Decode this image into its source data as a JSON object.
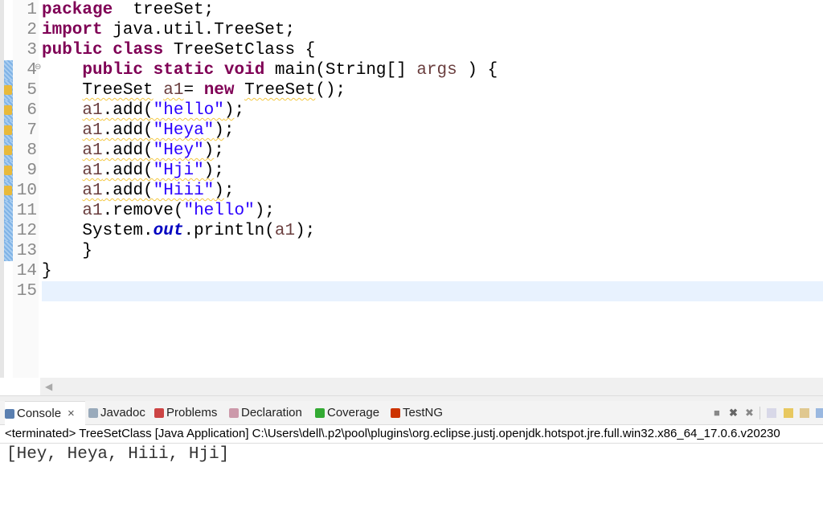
{
  "editor": {
    "lines": [
      {
        "n": "1",
        "t": [
          [
            "kw",
            "package"
          ],
          [
            "",
            "  treeSet;"
          ]
        ]
      },
      {
        "n": "2",
        "t": [
          [
            "kw",
            "import"
          ],
          [
            "",
            " java.util.TreeSet;"
          ]
        ]
      },
      {
        "n": "3",
        "t": [
          [
            "kw",
            "public"
          ],
          [
            "",
            " "
          ],
          [
            "kw",
            "class"
          ],
          [
            "",
            " TreeSetClass {"
          ]
        ]
      },
      {
        "n": "4",
        "fold": true,
        "t": [
          [
            "",
            "    "
          ],
          [
            "kw",
            "public"
          ],
          [
            "",
            " "
          ],
          [
            "kw",
            "static"
          ],
          [
            "",
            " "
          ],
          [
            "kw",
            "void"
          ],
          [
            "",
            " main(String[] "
          ],
          [
            "var",
            "args"
          ],
          [
            "",
            " ) {"
          ]
        ]
      },
      {
        "n": "5",
        "warn": true,
        "t": [
          [
            "",
            "    "
          ],
          [
            "sq",
            "TreeSet"
          ],
          [
            "",
            " "
          ],
          [
            "var sq",
            "a1"
          ],
          [
            "",
            "= "
          ],
          [
            "kw",
            "new"
          ],
          [
            "",
            " "
          ],
          [
            "sq",
            "TreeSet"
          ],
          [
            "",
            "();"
          ]
        ]
      },
      {
        "n": "6",
        "warn": true,
        "t": [
          [
            "",
            "    "
          ],
          [
            "var sq",
            "a1"
          ],
          [
            "sq",
            ".add("
          ],
          [
            "str sq",
            "\"hello\""
          ],
          [
            "sq",
            ")"
          ],
          [
            "",
            ";"
          ]
        ]
      },
      {
        "n": "7",
        "warn": true,
        "t": [
          [
            "",
            "    "
          ],
          [
            "var sq",
            "a1"
          ],
          [
            "sq",
            ".add("
          ],
          [
            "str sq",
            "\"Heya\""
          ],
          [
            "sq",
            ")"
          ],
          [
            "",
            ";"
          ]
        ]
      },
      {
        "n": "8",
        "warn": true,
        "t": [
          [
            "",
            "    "
          ],
          [
            "var sq",
            "a1"
          ],
          [
            "sq",
            ".add("
          ],
          [
            "str sq",
            "\"Hey\""
          ],
          [
            "sq",
            ")"
          ],
          [
            "",
            ";"
          ]
        ]
      },
      {
        "n": "9",
        "warn": true,
        "t": [
          [
            "",
            "    "
          ],
          [
            "var sq",
            "a1"
          ],
          [
            "sq",
            ".add("
          ],
          [
            "str sq",
            "\"Hji\""
          ],
          [
            "sq",
            ")"
          ],
          [
            "",
            ";"
          ]
        ]
      },
      {
        "n": "10",
        "warn": true,
        "t": [
          [
            "",
            "    "
          ],
          [
            "var sq",
            "a1"
          ],
          [
            "sq",
            ".add("
          ],
          [
            "str sq",
            "\"Hiii\""
          ],
          [
            "sq",
            ")"
          ],
          [
            "",
            ";"
          ]
        ]
      },
      {
        "n": "11",
        "t": [
          [
            "",
            "    "
          ],
          [
            "var",
            "a1"
          ],
          [
            "",
            ".remove("
          ],
          [
            "str",
            "\"hello\""
          ],
          [
            "",
            ");"
          ]
        ]
      },
      {
        "n": "12",
        "t": [
          [
            "",
            "    System."
          ],
          [
            "fld",
            "out"
          ],
          [
            "",
            ".println("
          ],
          [
            "var",
            "a1"
          ],
          [
            "",
            ");"
          ]
        ]
      },
      {
        "n": "13",
        "t": [
          [
            "",
            "    }"
          ]
        ]
      },
      {
        "n": "14",
        "t": [
          [
            "",
            "}"
          ]
        ]
      },
      {
        "n": "15",
        "cur": true,
        "t": []
      }
    ]
  },
  "tabs": [
    {
      "label": "Console",
      "icon": "console-icon",
      "close": "×",
      "active": true
    },
    {
      "label": "Javadoc",
      "icon": "javadoc-icon"
    },
    {
      "label": "Problems",
      "icon": "problems-icon"
    },
    {
      "label": "Declaration",
      "icon": "declaration-icon"
    },
    {
      "label": "Coverage",
      "icon": "coverage-icon"
    },
    {
      "label": "TestNG",
      "icon": "testng-icon"
    }
  ],
  "console": {
    "header": "<terminated> TreeSetClass [Java Application] C:\\Users\\dell\\.p2\\pool\\plugins\\org.eclipse.justj.openjdk.hotspot.jre.full.win32.x86_64_17.0.6.v20230",
    "output": "[Hey, Heya, Hiii, Hji]"
  }
}
